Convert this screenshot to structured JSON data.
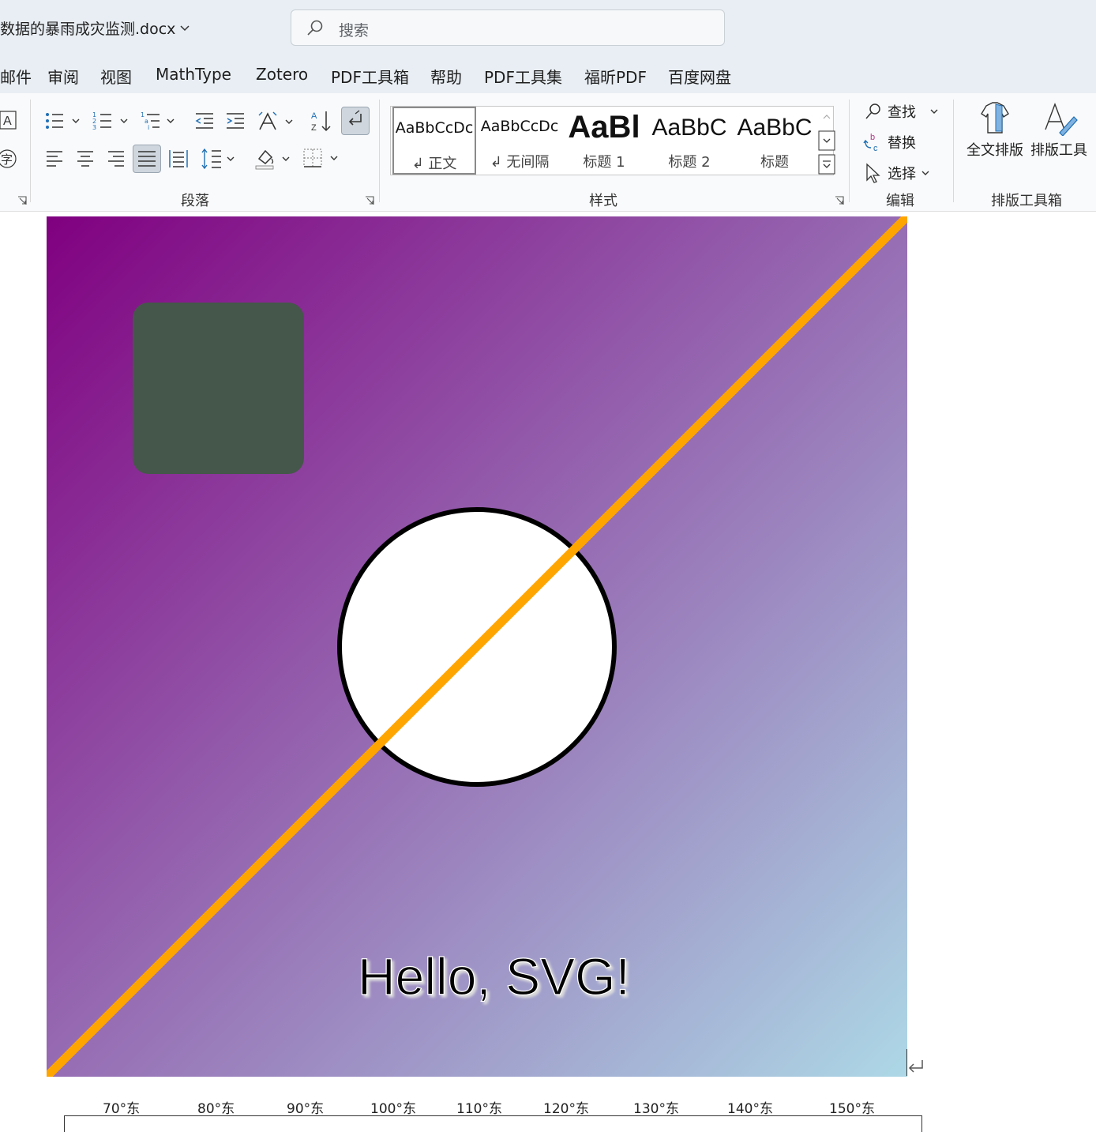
{
  "window": {
    "doc_title": "数据的暴雨成灾监测.docx",
    "search_placeholder": "搜索"
  },
  "menu": {
    "tabs": [
      "邮件",
      "审阅",
      "视图",
      "MathType",
      "Zotero",
      "PDF工具箱",
      "帮助",
      "PDF工具集",
      "福昕PDF",
      "百度网盘"
    ]
  },
  "ribbon": {
    "paragraph_group_label": "段落",
    "styles_group_label": "样式",
    "editing_group_label": "编辑",
    "layout_group_label": "排版工具箱",
    "styles": [
      {
        "preview": "AaBbCcDc",
        "name": "正文",
        "selected": true
      },
      {
        "preview": "AaBbCcDc",
        "name": "无间隔",
        "selected": false
      },
      {
        "preview": "AaBl",
        "name": "标题 1",
        "selected": false
      },
      {
        "preview": "AaBbC",
        "name": "标题 2",
        "selected": false
      },
      {
        "preview": "AaBbC",
        "name": "标题",
        "selected": false
      }
    ],
    "editing": {
      "find": "查找",
      "replace": "替换",
      "select": "选择"
    },
    "layout_tools": {
      "full_layout": "全文排版",
      "layout_tool": "排版工具"
    }
  },
  "figure": {
    "text": "Hello, SVG!",
    "gradient_start": "#800080",
    "gradient_end": "#add8e6",
    "square_color": "#45574a",
    "line_color": "#ffa500",
    "circle_fill": "#ffffff",
    "circle_stroke": "#000000"
  },
  "map_axis": {
    "labels": [
      "70°东",
      "80°东",
      "90°东",
      "100°东",
      "110°东",
      "120°东",
      "130°东",
      "140°东",
      "150°东"
    ]
  }
}
